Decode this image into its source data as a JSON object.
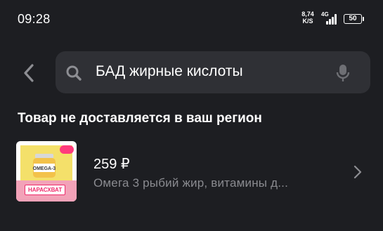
{
  "status_bar": {
    "time": "09:28",
    "net_speed_value": "8,74",
    "net_speed_unit": "K/S",
    "network_type": "4G",
    "battery": "50"
  },
  "search": {
    "query": "БАД жирные кислоты"
  },
  "notice": {
    "text": "Товар не доставляется в ваш регион"
  },
  "product": {
    "price": "259 ₽",
    "description": "Омега 3 рыбий жир, витамины д...",
    "image": {
      "brand_text": "OMEGA-3",
      "promo_label": "НАРАСХВАТ"
    }
  },
  "colors": {
    "background": "#1d1e22",
    "search_background": "#2f3035",
    "secondary_text": "#8a8b90",
    "promo_accent": "#ee2b6b"
  }
}
